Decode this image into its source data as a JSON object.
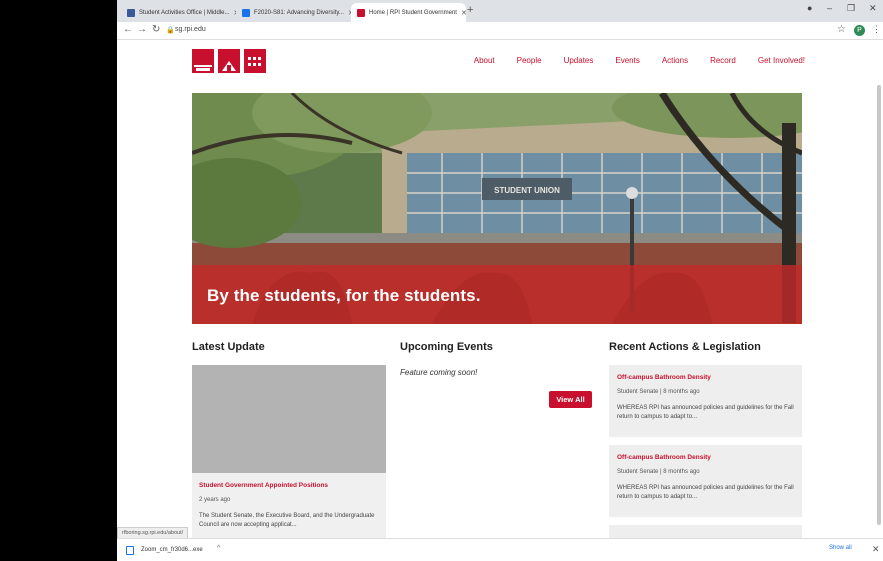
{
  "browser": {
    "tabs": [
      {
        "label": "Student Activities Office | Middle...",
        "color": "#3b5998"
      },
      {
        "label": "F2020-S81: Advancing Diversity...",
        "color": "#1a73e8"
      },
      {
        "label": "Home | RPI Student Government",
        "color": "#c8102e"
      }
    ],
    "url": "sg.rpi.edu",
    "avatar_initial": "P",
    "status_url": "rfboring.sg.rpi.edu/about/",
    "download_name": "Zoom_cm_fr30d6...exe",
    "show_all": "Show all"
  },
  "site": {
    "nav": [
      "About",
      "People",
      "Updates",
      "Events",
      "Actions",
      "Record",
      "Get Involved!"
    ],
    "hero_text": "By the students, for the students.",
    "hero_sign": "STUDENT UNION",
    "sections": {
      "latest_update": "Latest Update",
      "upcoming_events": "Upcoming Events",
      "recent_actions": "Recent Actions & Legislation"
    },
    "latest_update": {
      "title": "Student Government Appointed Positions",
      "age": "2 years ago",
      "body": "The Student Senate, the Executive Board, and the Undergraduate Council are now accepting applicat..."
    },
    "events": {
      "note": "Feature coming soon!",
      "view_all": "View All"
    },
    "actions": [
      {
        "title": "Off-campus Bathroom Density",
        "meta": "Student Senate | 8 months ago",
        "body": "WHEREAS RPI has announced policies and guidelines for the Fall return to campus to adapt to..."
      },
      {
        "title": "Off-campus Bathroom Density",
        "meta": "Student Senate | 8 months ago",
        "body": "WHEREAS RPI has announced policies and guidelines for the Fall return to campus to adapt to..."
      }
    ]
  },
  "colors": {
    "brand_red": "#c8102e",
    "card_gray": "#eeeeee"
  }
}
